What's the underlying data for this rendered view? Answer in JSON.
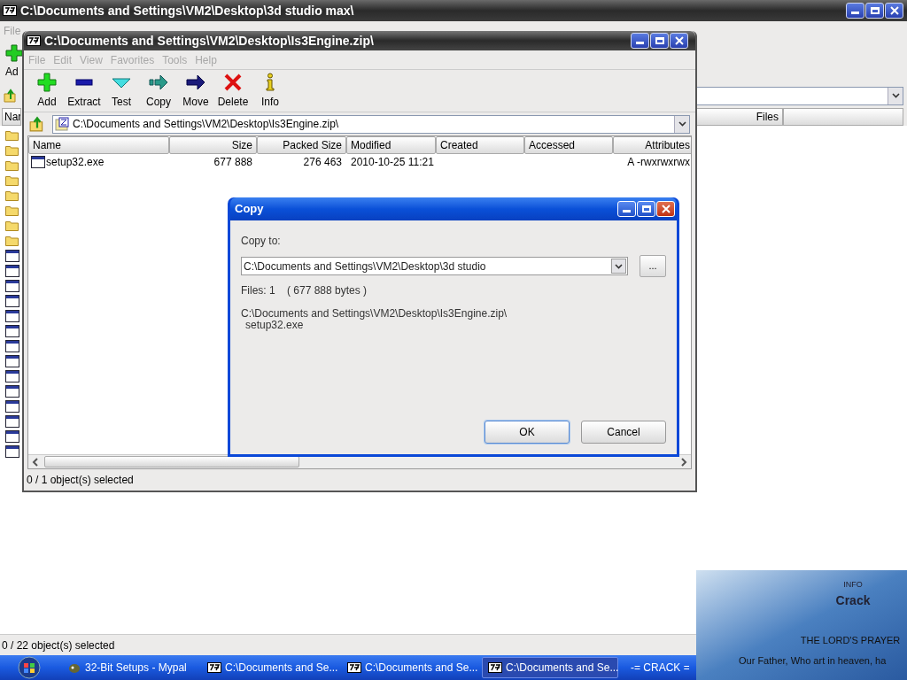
{
  "background_window": {
    "title": "C:\\Documents and Settings\\VM2\\Desktop\\3d studio max\\",
    "menu": [
      {
        "label": "File",
        "disabled": true
      }
    ],
    "toolbar_partial": "Ad",
    "column_headers": [
      "Nar",
      "Files"
    ],
    "status_bar": "0 / 22 object(s) selected"
  },
  "archive_window": {
    "title": "C:\\Documents and Settings\\VM2\\Desktop\\Is3Engine.zip\\",
    "menu": [
      {
        "label": "File",
        "disabled": true
      },
      {
        "label": "Edit",
        "disabled": true
      },
      {
        "label": "View",
        "disabled": true
      },
      {
        "label": "Favorites",
        "disabled": true
      },
      {
        "label": "Tools",
        "disabled": true
      },
      {
        "label": "Help",
        "disabled": true
      }
    ],
    "toolbar": [
      {
        "kind": "add",
        "label": "Add"
      },
      {
        "kind": "extract",
        "label": "Extract"
      },
      {
        "kind": "test",
        "label": "Test"
      },
      {
        "kind": "copy",
        "label": "Copy"
      },
      {
        "kind": "move",
        "label": "Move"
      },
      {
        "kind": "delete",
        "label": "Delete"
      },
      {
        "kind": "info",
        "label": "Info"
      }
    ],
    "address": "C:\\Documents and Settings\\VM2\\Desktop\\Is3Engine.zip\\",
    "table": {
      "columns": [
        "Name",
        "Size",
        "Packed Size",
        "Modified",
        "Created",
        "Accessed",
        "Attributes"
      ],
      "rows": [
        {
          "name": "setup32.exe",
          "size": "677 888",
          "packed_size": "276 463",
          "modified": "2010-10-25 11:21",
          "attributes": "A -rwxrwxrwx"
        }
      ]
    },
    "status_bar": "0 / 1 object(s) selected"
  },
  "copy_dialog": {
    "title": "Copy",
    "label": "Copy to:",
    "value": "C:\\Documents and Settings\\VM2\\Desktop\\3d studio",
    "browse": "...",
    "files": "Files: 1    ( 677 888 bytes )",
    "source_path": "C:\\Documents and Settings\\VM2\\Desktop\\Is3Engine.zip\\",
    "source_file": "setup32.exe",
    "buttons": [
      {
        "label": "OK",
        "default": true
      },
      {
        "label": "Cancel",
        "default": false
      }
    ]
  },
  "taskbar": {
    "items": [
      {
        "kind": "browser",
        "label": "32-Bit Setups - Mypal",
        "selected": false
      },
      {
        "kind": "archiver",
        "label": "C:\\Documents and Se...",
        "selected": false
      },
      {
        "kind": "archiver",
        "label": "C:\\Documents and Se...",
        "selected": false
      },
      {
        "kind": "archiver",
        "label": "C:\\Documents and Se...",
        "selected": true
      },
      {
        "kind": "app",
        "label": "-= CRACK =",
        "selected": false
      }
    ]
  },
  "desktop_note": {
    "heading": "INFO",
    "title": "Crack",
    "subtitle": "THE LORD'S PRAYER",
    "line": "Our Father, Who art in heaven, ha"
  }
}
